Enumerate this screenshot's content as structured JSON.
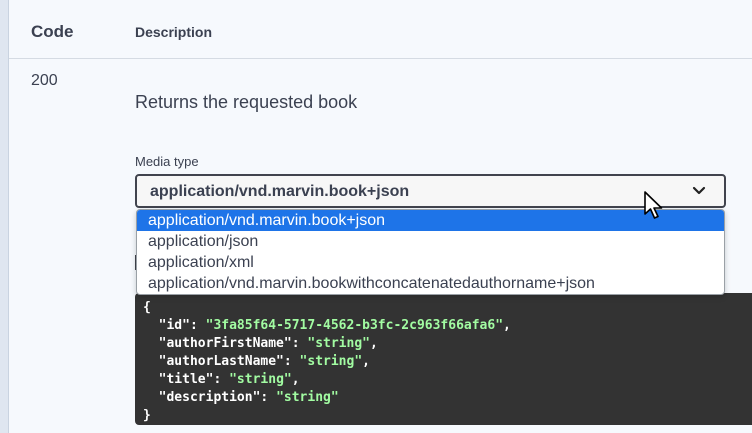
{
  "table": {
    "header_code": "Code",
    "header_description": "Description"
  },
  "response": {
    "code": "200",
    "description": "Returns the requested book",
    "media_type_label": "Media type",
    "selected_media_type": "application/vnd.marvin.book+json",
    "options": [
      "application/vnd.marvin.book+json",
      "application/json",
      "application/xml",
      "application/vnd.marvin.bookwithconcatenatedauthorname+json"
    ]
  },
  "example": {
    "open_brace": "{",
    "close_brace": "}",
    "fields": [
      {
        "key": "\"id\"",
        "value": "\"3fa85f64-5717-4562-b3fc-2c963f66afa6\"",
        "trail": ","
      },
      {
        "key": "\"authorFirstName\"",
        "value": "\"string\"",
        "trail": ","
      },
      {
        "key": "\"authorLastName\"",
        "value": "\"string\"",
        "trail": ","
      },
      {
        "key": "\"title\"",
        "value": "\"string\"",
        "trail": ","
      },
      {
        "key": "\"description\"",
        "value": "\"string\"",
        "trail": ""
      }
    ]
  },
  "icons": {
    "dropdown": "chevron-down-icon",
    "pointer": "mouse-pointer-icon"
  }
}
